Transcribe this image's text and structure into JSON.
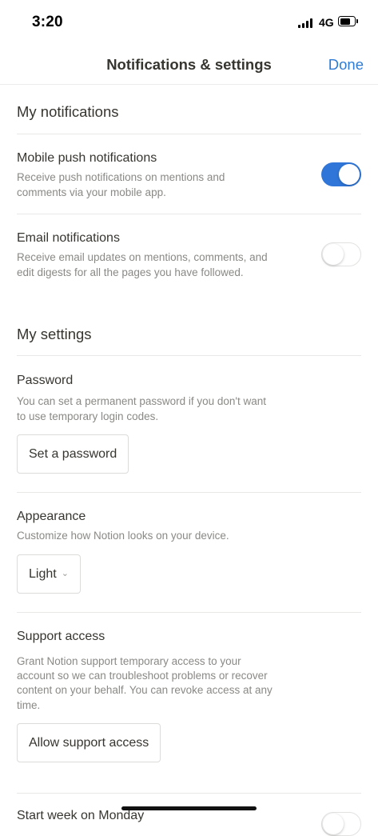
{
  "status_bar": {
    "time": "3:20",
    "network": "4G"
  },
  "nav": {
    "title": "Notifications & settings",
    "done_label": "Done"
  },
  "notifications": {
    "heading": "My notifications",
    "mobile_push": {
      "title": "Mobile push notifications",
      "desc_line1": "Receive push notifications on mentions and",
      "desc_line2": "comments via your mobile app.",
      "enabled": true
    },
    "email": {
      "title": "Email notifications",
      "desc_line1": "Receive email updates on mentions, comments, and",
      "desc_line2": "edit digests for all the pages you have followed.",
      "enabled": false
    }
  },
  "settings": {
    "heading": "My settings",
    "password": {
      "title": "Password",
      "desc_line1": "You can set a permanent password if you don't want",
      "desc_line2": "to use temporary login codes.",
      "button_label": "Set a password"
    },
    "appearance": {
      "title": "Appearance",
      "desc": "Customize how Notion looks on your device.",
      "selected": "Light"
    },
    "support": {
      "title": "Support access",
      "desc_line1": "Grant Notion support temporary access to your",
      "desc_line2": "account so we can troubleshoot problems or recover",
      "desc_line3": "content on your behalf. You can revoke access at any",
      "desc_line4": "time.",
      "button_label": "Allow support access"
    },
    "week": {
      "title": "Start week on Monday",
      "enabled": false
    }
  },
  "colors": {
    "accent": "#2e7cd6",
    "toggle_on": "#2f76d8",
    "text": "#37352f",
    "muted": "#8a8985"
  }
}
